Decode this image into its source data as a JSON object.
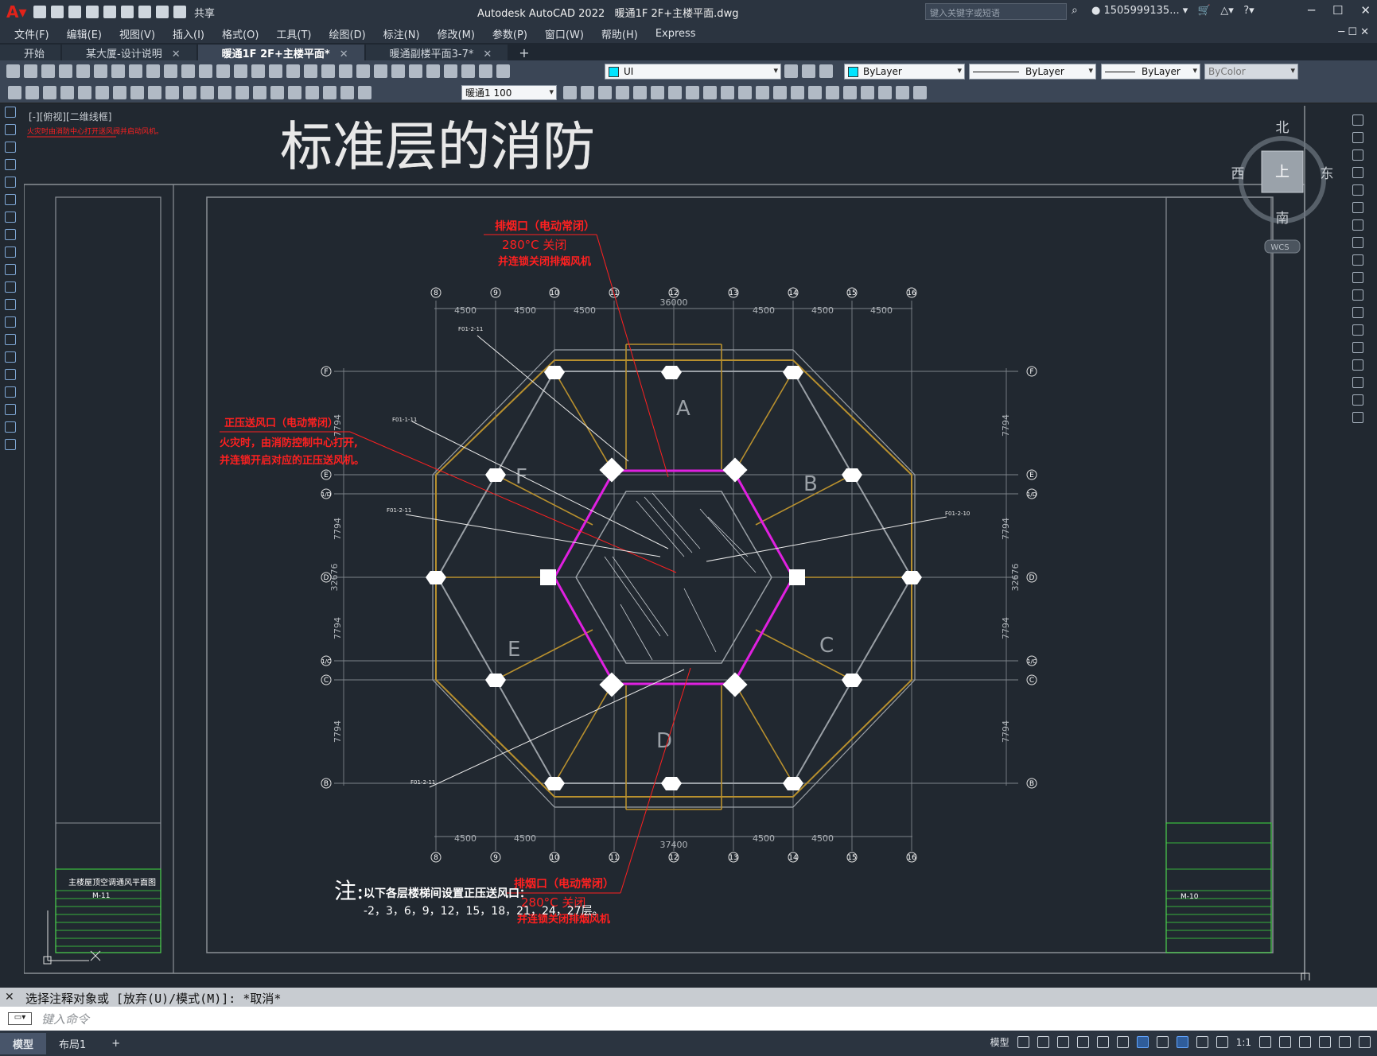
{
  "app": {
    "title": "Autodesk AutoCAD 2022",
    "file": "暖通1F 2F+主楼平面.dwg",
    "share_label": "共享",
    "search_placeholder": "键入关键字或短语",
    "user": "1505999135..."
  },
  "menu": [
    "文件(F)",
    "编辑(E)",
    "视图(V)",
    "插入(I)",
    "格式(O)",
    "工具(T)",
    "绘图(D)",
    "标注(N)",
    "修改(M)",
    "参数(P)",
    "窗口(W)",
    "帮助(H)",
    "Express"
  ],
  "tabs": [
    {
      "label": "开始",
      "closable": false
    },
    {
      "label": "某大厦-设计说明",
      "closable": true
    },
    {
      "label": "暖通1F 2F+主楼平面*",
      "closable": true,
      "active": true
    },
    {
      "label": "暖通副楼平面3-7*",
      "closable": true
    }
  ],
  "layer_dropdown": "UI",
  "props": {
    "color": "ByLayer",
    "linetype": "ByLayer",
    "lineweight": "ByLayer",
    "plotstyle": "ByColor"
  },
  "annotation_scale": "暖通1  100",
  "view_label": "[-][俯视][二维线框]",
  "viewcube": {
    "north": "北",
    "south": "南",
    "east": "东",
    "west": "西",
    "top": "上",
    "wcs": "WCS"
  },
  "drawing": {
    "title": "标准层的消防",
    "grid_top": [
      "8",
      "9",
      "10",
      "11",
      "12",
      "13",
      "14",
      "15",
      "16"
    ],
    "grid_bottom": [
      "8",
      "9",
      "10",
      "11",
      "12",
      "13",
      "14",
      "15",
      "16"
    ],
    "grid_rows_left": [
      "F",
      "E",
      "1/D",
      "D",
      "1/C",
      "C",
      "B"
    ],
    "dims_top": [
      "4500",
      "4500",
      "4500",
      "36000",
      "4500",
      "4500",
      "4500"
    ],
    "dims_bottom": [
      "4500",
      "4500",
      "37400",
      "4500",
      "4500"
    ],
    "dims_side": [
      "7794",
      "7794",
      "32676",
      "7794",
      "7794"
    ],
    "units": [
      "A",
      "B",
      "C",
      "D",
      "E",
      "F"
    ],
    "note_top_1": "排烟口（电动常闭）",
    "note_top_2": "280°C 关闭",
    "note_top_3": "并连锁关闭排烟风机",
    "note_left_1": "正压送风口（电动常闭）",
    "note_left_2": "火灾时，由消防控制中心打开,",
    "note_left_3": "并连锁开启对应的正压送风机。",
    "note_bottom_1": "排烟口（电动常闭）",
    "note_bottom_2": "280°C 关闭",
    "note_bottom_3": "并连锁关闭排烟风机",
    "remark_label": "注:",
    "remark_1": "以下各层楼梯间设置正压送风口：",
    "remark_2": "-2，3，6，9，12，15，18，21，24，27层。",
    "titleblock_left_title": "主楼屋顶空调通风平面图",
    "titleblock_left_no": "M-11",
    "titleblock_right_no": "M-10"
  },
  "command_history": "选择注释对象或 [放弃(U)/模式(M)]: *取消*",
  "command_placeholder": "键入命令",
  "status_tabs": [
    "模型",
    "布局1"
  ],
  "status_scale": "1:1",
  "colors": {
    "accent": "#3b4656",
    "red_text": "#ff2020",
    "wall": "#b8902e",
    "magenta": "#e020e0",
    "grid": "#9aa0a6"
  }
}
